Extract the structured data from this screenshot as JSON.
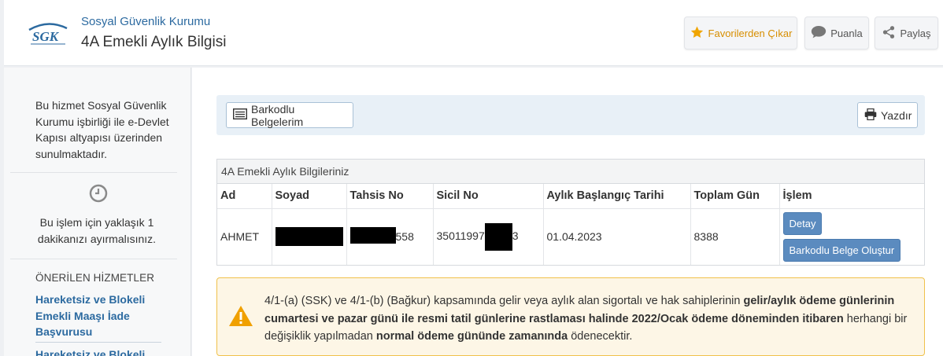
{
  "header": {
    "logo_text": "SGK",
    "org_name": "Sosyal Güvenlik Kurumu",
    "title": "4A Emekli Aylık Bilgisi",
    "fav_label": "Favorilerden Çıkar",
    "rate_label": "Puanla",
    "share_label": "Paylaş"
  },
  "sidebar": {
    "info": "Bu hizmet Sosyal Güvenlik Kurumu işbirliği ile e-Devlet Kapısı altyapısı üzerinden sunulmaktadır.",
    "time_note": "Bu işlem için yaklaşık 1 dakikanızı ayırmalısınız.",
    "suggested_heading": "ÖNERİLEN HİZMETLER",
    "links": [
      "Hareketsiz ve Blokeli Emekli Maaşı İade Başvurusu",
      "Hareketsiz ve Blokeli"
    ]
  },
  "toolbar": {
    "barkod_label": "Barkodlu Belgelerim",
    "print_label": "Yazdır"
  },
  "panel": {
    "title": "4A Emekli Aylık Bilgileriniz",
    "columns": [
      "Ad",
      "Soyad",
      "Tahsis No",
      "Sicil No",
      "Aylık Başlangıç Tarihi",
      "Toplam Gün",
      "İşlem"
    ],
    "row": {
      "ad": "AHMET",
      "tahsis_suffix": "558",
      "sicil_prefix": "35011997",
      "sicil_suffix": "3",
      "baslangic": "01.04.2023",
      "toplam_gun": "8388",
      "detay_label": "Detay",
      "belge_label": "Barkodlu Belge Oluştur"
    }
  },
  "warning": {
    "part1": "4/1-(a) (SSK) ve 4/1-(b) (Bağkur) kapsamında gelir veya aylık alan sigortalı ve hak sahiplerinin ",
    "bold1": "gelir/aylık ödeme günlerinin cumartesi ve pazar günü ile resmi tatil günlerine rastlaması halinde 2022/Ocak ödeme döneminden itibaren",
    "part2": " herhangi bir değişiklik yapılmadan ",
    "bold2": "normal ödeme gününde zamanında",
    "part3": " ödenecektir."
  },
  "colors": {
    "brand_blue": "#2c6aa0",
    "fav_star": "#f0a500",
    "action_button": "#5b8bbf",
    "warning_border": "#f0c14b",
    "warning_icon": "#f0a000"
  }
}
